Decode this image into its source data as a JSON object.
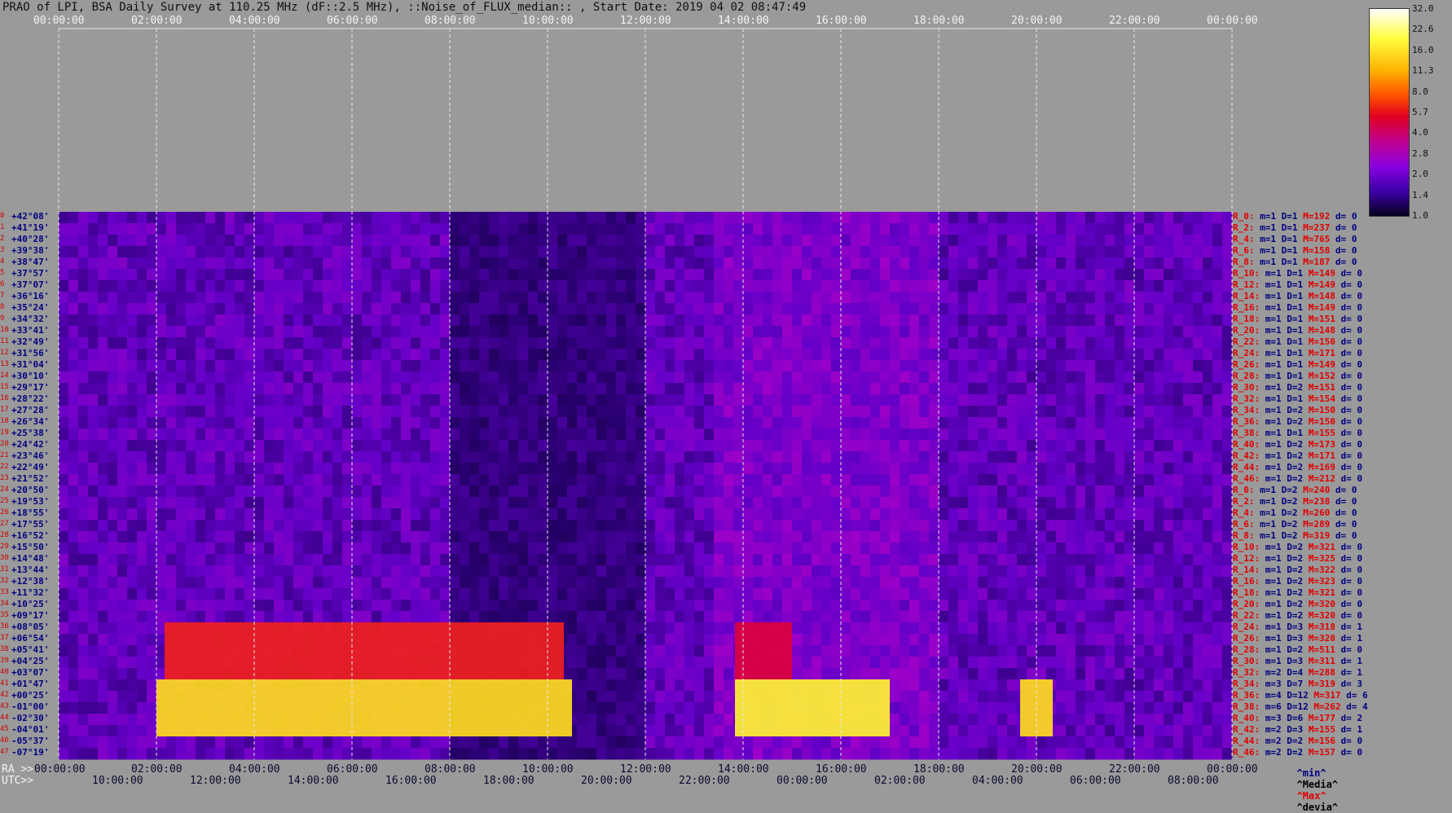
{
  "title": "PRAO of LPI, BSA Daily Survey at 110.25 MHz (dF::2.5 MHz), ::Noise_of_FLUX_median:: , Start Date: 2019 04 02 08:47:49",
  "top_time_ticks": [
    "00:00:00",
    "02:00:00",
    "04:00:00",
    "06:00:00",
    "08:00:00",
    "10:00:00",
    "12:00:00",
    "14:00:00",
    "16:00:00",
    "18:00:00",
    "20:00:00",
    "22:00:00",
    "00:00:00"
  ],
  "ra_prefix": "RA >>",
  "ra_ticks": [
    "00:00:00",
    "02:00:00",
    "04:00:00",
    "06:00:00",
    "08:00:00",
    "10:00:00",
    "12:00:00",
    "14:00:00",
    "16:00:00",
    "18:00:00",
    "20:00:00",
    "22:00:00",
    "00:00:00"
  ],
  "utc_prefix": "UTC>>",
  "utc_ticks": [
    "10:00:00",
    "12:00:00",
    "14:00:00",
    "16:00:00",
    "18:00:00",
    "20:00:00",
    "22:00:00",
    "00:00:00",
    "02:00:00",
    "04:00:00",
    "06:00:00",
    "08:00:00"
  ],
  "colorbar": {
    "ticks": [
      "32.0",
      "22.6",
      "16.0",
      "11.3",
      "8.0",
      "5.7",
      "4.0",
      "2.8",
      "2.0",
      "1.4",
      "1.0"
    ]
  },
  "legend_bottom": {
    "min": "^min^",
    "media": "^Media^",
    "max": "^Max^",
    "devia": "^devia^"
  },
  "chart_data": {
    "type": "heatmap",
    "title": "PRAO of LPI, BSA Daily Survey at 110.25 MHz (dF::2.5 MHz), ::Noise_of_FLUX_median:: , Start Date: 2019 04 02 08:47:49",
    "xlabel": "RA / UTC",
    "ylabel": "",
    "colorscale_range": [
      1.0,
      32.0
    ],
    "declinations": [
      "+42°08'",
      "+41°19'",
      "+40°28'",
      "+39°38'",
      "+38°47'",
      "+37°57'",
      "+37°07'",
      "+36°16'",
      "+35°24'",
      "+34°32'",
      "+33°41'",
      "+32°49'",
      "+31°56'",
      "+31°04'",
      "+30°10'",
      "+29°17'",
      "+28°22'",
      "+27°28'",
      "+26°34'",
      "+25°38'",
      "+24°42'",
      "+23°46'",
      "+22°49'",
      "+21°52'",
      "+20°50'",
      "+19°53'",
      "+18°55'",
      "+17°55'",
      "+16°52'",
      "+15°50'",
      "+14°48'",
      "+13°44'",
      "+12°38'",
      "+11°32'",
      "+10°25'",
      "+09°17'",
      "+08°05'",
      "+06°54'",
      "+05°41'",
      "+04°25'",
      "+03°07'",
      "+01°47'",
      "+00°25'",
      "-01°00'",
      "-02°30'",
      "-04°01'",
      "-05°37'",
      "-07°19'"
    ],
    "row_stats": [
      {
        "r": "R_0:",
        "m": "m=1",
        "d": "D=1",
        "M": "M=192",
        "dv": "d= 0"
      },
      {
        "r": "R_2:",
        "m": "m=1",
        "d": "D=1",
        "M": "M=237",
        "dv": "d= 0"
      },
      {
        "r": "R_4:",
        "m": "m=1",
        "d": "D=1",
        "M": "M=765",
        "dv": "d= 0"
      },
      {
        "r": "R_6:",
        "m": "m=1",
        "d": "D=1",
        "M": "M=158",
        "dv": "d= 0"
      },
      {
        "r": "R_8:",
        "m": "m=1",
        "d": "D=1",
        "M": "M=187",
        "dv": "d= 0"
      },
      {
        "r": "R_10:",
        "m": "m=1",
        "d": "D=1",
        "M": "M=149",
        "dv": "d= 0"
      },
      {
        "r": "R_12:",
        "m": "m=1",
        "d": "D=1",
        "M": "M=149",
        "dv": "d= 0"
      },
      {
        "r": "R_14:",
        "m": "m=1",
        "d": "D=1",
        "M": "M=148",
        "dv": "d= 0"
      },
      {
        "r": "R_16:",
        "m": "m=1",
        "d": "D=1",
        "M": "M=149",
        "dv": "d= 0"
      },
      {
        "r": "R_18:",
        "m": "m=1",
        "d": "D=1",
        "M": "M=151",
        "dv": "d= 0"
      },
      {
        "r": "R_20:",
        "m": "m=1",
        "d": "D=1",
        "M": "M=148",
        "dv": "d= 0"
      },
      {
        "r": "R_22:",
        "m": "m=1",
        "d": "D=1",
        "M": "M=150",
        "dv": "d= 0"
      },
      {
        "r": "R_24:",
        "m": "m=1",
        "d": "D=1",
        "M": "M=171",
        "dv": "d= 0"
      },
      {
        "r": "R_26:",
        "m": "m=1",
        "d": "D=1",
        "M": "M=149",
        "dv": "d= 0"
      },
      {
        "r": "R_28:",
        "m": "m=1",
        "d": "D=1",
        "M": "M=152",
        "dv": "d= 0"
      },
      {
        "r": "R_30:",
        "m": "m=1",
        "d": "D=2",
        "M": "M=151",
        "dv": "d= 0"
      },
      {
        "r": "R_32:",
        "m": "m=1",
        "d": "D=1",
        "M": "M=154",
        "dv": "d= 0"
      },
      {
        "r": "R_34:",
        "m": "m=1",
        "d": "D=2",
        "M": "M=150",
        "dv": "d= 0"
      },
      {
        "r": "R_36:",
        "m": "m=1",
        "d": "D=2",
        "M": "M=150",
        "dv": "d= 0"
      },
      {
        "r": "R_38:",
        "m": "m=1",
        "d": "D=1",
        "M": "M=155",
        "dv": "d= 0"
      },
      {
        "r": "R_40:",
        "m": "m=1",
        "d": "D=2",
        "M": "M=173",
        "dv": "d= 0"
      },
      {
        "r": "R_42:",
        "m": "m=1",
        "d": "D=2",
        "M": "M=171",
        "dv": "d= 0"
      },
      {
        "r": "R_44:",
        "m": "m=1",
        "d": "D=2",
        "M": "M=169",
        "dv": "d= 0"
      },
      {
        "r": "R_46:",
        "m": "m=1",
        "d": "D=2",
        "M": "M=212",
        "dv": "d= 0"
      },
      {
        "r": "R_0:",
        "m": "m=1",
        "d": "D=2",
        "M": "M=240",
        "dv": "d= 0"
      },
      {
        "r": "R_2:",
        "m": "m=1",
        "d": "D=2",
        "M": "M=238",
        "dv": "d= 0"
      },
      {
        "r": "R_4:",
        "m": "m=1",
        "d": "D=2",
        "M": "M=260",
        "dv": "d= 0"
      },
      {
        "r": "R_6:",
        "m": "m=1",
        "d": "D=2",
        "M": "M=289",
        "dv": "d= 0"
      },
      {
        "r": "R_8:",
        "m": "m=1",
        "d": "D=2",
        "M": "M=319",
        "dv": "d= 0"
      },
      {
        "r": "R_10:",
        "m": "m=1",
        "d": "D=2",
        "M": "M=321",
        "dv": "d= 0"
      },
      {
        "r": "R_12:",
        "m": "m=1",
        "d": "D=2",
        "M": "M=325",
        "dv": "d= 0"
      },
      {
        "r": "R_14:",
        "m": "m=1",
        "d": "D=2",
        "M": "M=322",
        "dv": "d= 0"
      },
      {
        "r": "R_16:",
        "m": "m=1",
        "d": "D=2",
        "M": "M=323",
        "dv": "d= 0"
      },
      {
        "r": "R_18:",
        "m": "m=1",
        "d": "D=2",
        "M": "M=321",
        "dv": "d= 0"
      },
      {
        "r": "R_20:",
        "m": "m=1",
        "d": "D=2",
        "M": "M=320",
        "dv": "d= 0"
      },
      {
        "r": "R_22:",
        "m": "m=1",
        "d": "D=2",
        "M": "M=320",
        "dv": "d= 0"
      },
      {
        "r": "R_24:",
        "m": "m=1",
        "d": "D=3",
        "M": "M=318",
        "dv": "d= 1"
      },
      {
        "r": "R_26:",
        "m": "m=1",
        "d": "D=3",
        "M": "M=320",
        "dv": "d= 1"
      },
      {
        "r": "R_28:",
        "m": "m=1",
        "d": "D=2",
        "M": "M=511",
        "dv": "d= 0"
      },
      {
        "r": "R_30:",
        "m": "m=1",
        "d": "D=3",
        "M": "M=311",
        "dv": "d= 1"
      },
      {
        "r": "R_32:",
        "m": "m=2",
        "d": "D=4",
        "M": "M=288",
        "dv": "d= 1"
      },
      {
        "r": "R_34:",
        "m": "m=3",
        "d": "D=7",
        "M": "M=319",
        "dv": "d= 3"
      },
      {
        "r": "R_36:",
        "m": "m=4",
        "d": "D=12",
        "M": "M=317",
        "dv": "d= 6"
      },
      {
        "r": "R_38:",
        "m": "m=6",
        "d": "D=12",
        "M": "M=262",
        "dv": "d= 4"
      },
      {
        "r": "R_40:",
        "m": "m=3",
        "d": "D=6",
        "M": "M=177",
        "dv": "d= 2"
      },
      {
        "r": "R_42:",
        "m": "m=2",
        "d": "D=3",
        "M": "M=155",
        "dv": "d= 1"
      },
      {
        "r": "R_44:",
        "m": "m=2",
        "d": "D=2",
        "M": "M=156",
        "dv": "d= 0"
      },
      {
        "r": "R_46:",
        "m": "m=2",
        "d": "D=2",
        "M": "M=157",
        "dv": "d= 0"
      }
    ],
    "bright_bands": [
      {
        "rows": [
          41,
          45
        ],
        "ra_start": "02:00:00",
        "ra_end": "10:30:00",
        "level": 22
      },
      {
        "rows": [
          41,
          45
        ],
        "ra_start": "13:50:00",
        "ra_end": "17:00:00",
        "level": 24
      },
      {
        "rows": [
          41,
          45
        ],
        "ra_start": "19:40:00",
        "ra_end": "20:20:00",
        "level": 22
      },
      {
        "rows": [
          36,
          40
        ],
        "ra_start": "02:10:00",
        "ra_end": "10:20:00",
        "level": 10
      },
      {
        "rows": [
          36,
          40
        ],
        "ra_start": "13:50:00",
        "ra_end": "15:00:00",
        "level": 8
      }
    ]
  }
}
